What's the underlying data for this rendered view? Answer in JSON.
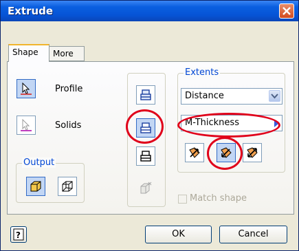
{
  "window": {
    "title": "Extrude"
  },
  "tabs": [
    {
      "label": "Shape"
    },
    {
      "label": "More"
    }
  ],
  "modes": [
    {
      "label": "Profile",
      "icon": "cursor-arrow-icon",
      "active": true
    },
    {
      "label": "Solids",
      "icon": "cursor-arrow-icon",
      "active": false
    }
  ],
  "output": {
    "legend": "Output",
    "buttons": [
      "solid-box-icon",
      "surface-box-icon"
    ]
  },
  "operations": [
    "join-icon",
    "cut-icon",
    "intersect-icon",
    "new-solid-icon"
  ],
  "extents": {
    "legend": "Extents",
    "type_value": "Distance",
    "distance_value": "M-Thickness",
    "directions": [
      "direction-1-icon",
      "direction-2-icon",
      "symmetric-icon"
    ]
  },
  "match_shape": {
    "label": "Match shape",
    "checked": false,
    "enabled": false
  },
  "footer": {
    "ok_label": "OK",
    "cancel_label": "Cancel"
  },
  "colors": {
    "title_bar": "#0a5fe0",
    "highlight_oval": "#e0001a",
    "legend_text": "#0046d5"
  }
}
